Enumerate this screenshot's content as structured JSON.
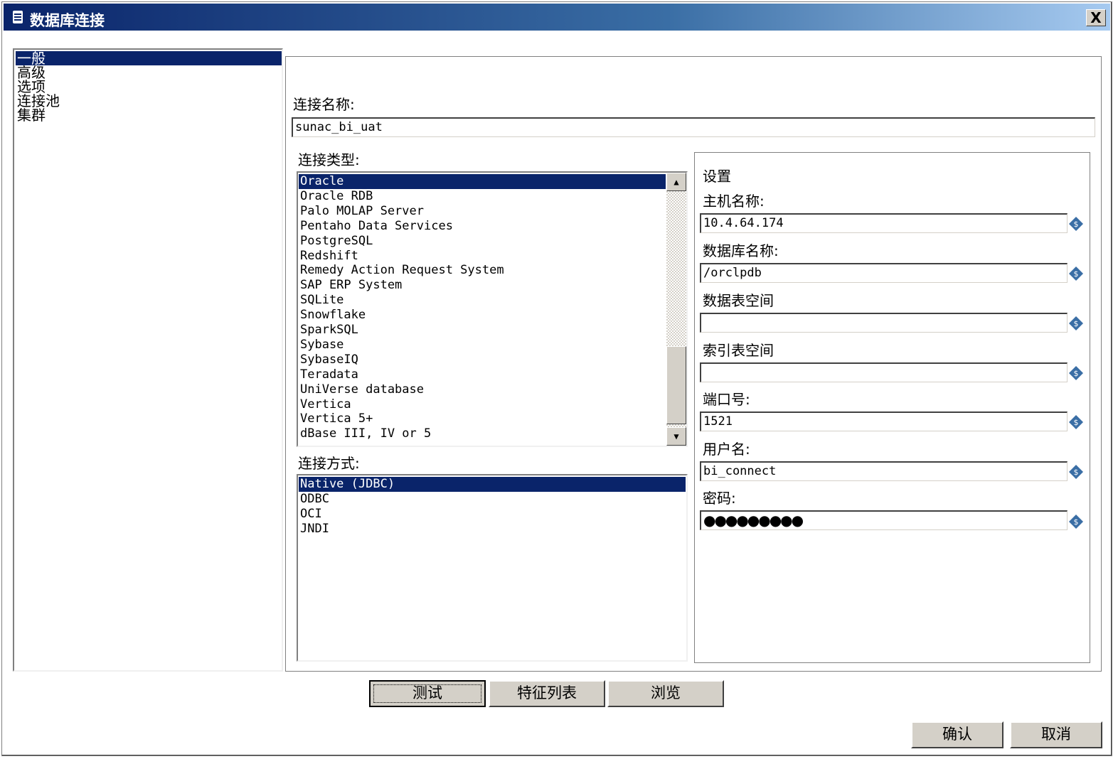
{
  "window": {
    "title": "数据库连接",
    "close_symbol": "X"
  },
  "nav": {
    "items": [
      "一般",
      "高级",
      "选项",
      "连接池",
      "集群"
    ],
    "selected_index": 0
  },
  "general": {
    "connection_name_label": "连接名称:",
    "connection_name_value": "sunac_bi_uat",
    "connection_type_label": "连接类型:",
    "connection_types": [
      "Oracle",
      "Oracle RDB",
      "Palo MOLAP Server",
      "Pentaho Data Services",
      "PostgreSQL",
      "Redshift",
      "Remedy Action Request System",
      "SAP ERP System",
      "SQLite",
      "Snowflake",
      "SparkSQL",
      "Sybase",
      "SybaseIQ",
      "Teradata",
      "UniVerse database",
      "Vertica",
      "Vertica 5+",
      "dBase III, IV or 5"
    ],
    "selected_type_index": 0,
    "access_label": "连接方式:",
    "access_methods": [
      "Native (JDBC)",
      "ODBC",
      "OCI",
      "JNDI"
    ],
    "selected_access_index": 0
  },
  "settings": {
    "title": "设置",
    "host_label": "主机名称:",
    "host_value": "10.4.64.174",
    "db_label": "数据库名称:",
    "db_value": "/orclpdb",
    "data_tablespace_label": "数据表空间",
    "data_tablespace_value": "",
    "index_tablespace_label": "索引表空间",
    "index_tablespace_value": "",
    "port_label": "端口号:",
    "port_value": "1521",
    "user_label": "用户名:",
    "user_value": "bi_connect",
    "password_label": "密码:",
    "password_value": "●●●●●●●●●"
  },
  "buttons": {
    "test": "测试",
    "features": "特征列表",
    "explore": "浏览",
    "ok": "确认",
    "cancel": "取消"
  },
  "colors": {
    "selection": "#0a246a",
    "titlebar": "#0a246a",
    "variable_icon": "#3a6ea5"
  }
}
